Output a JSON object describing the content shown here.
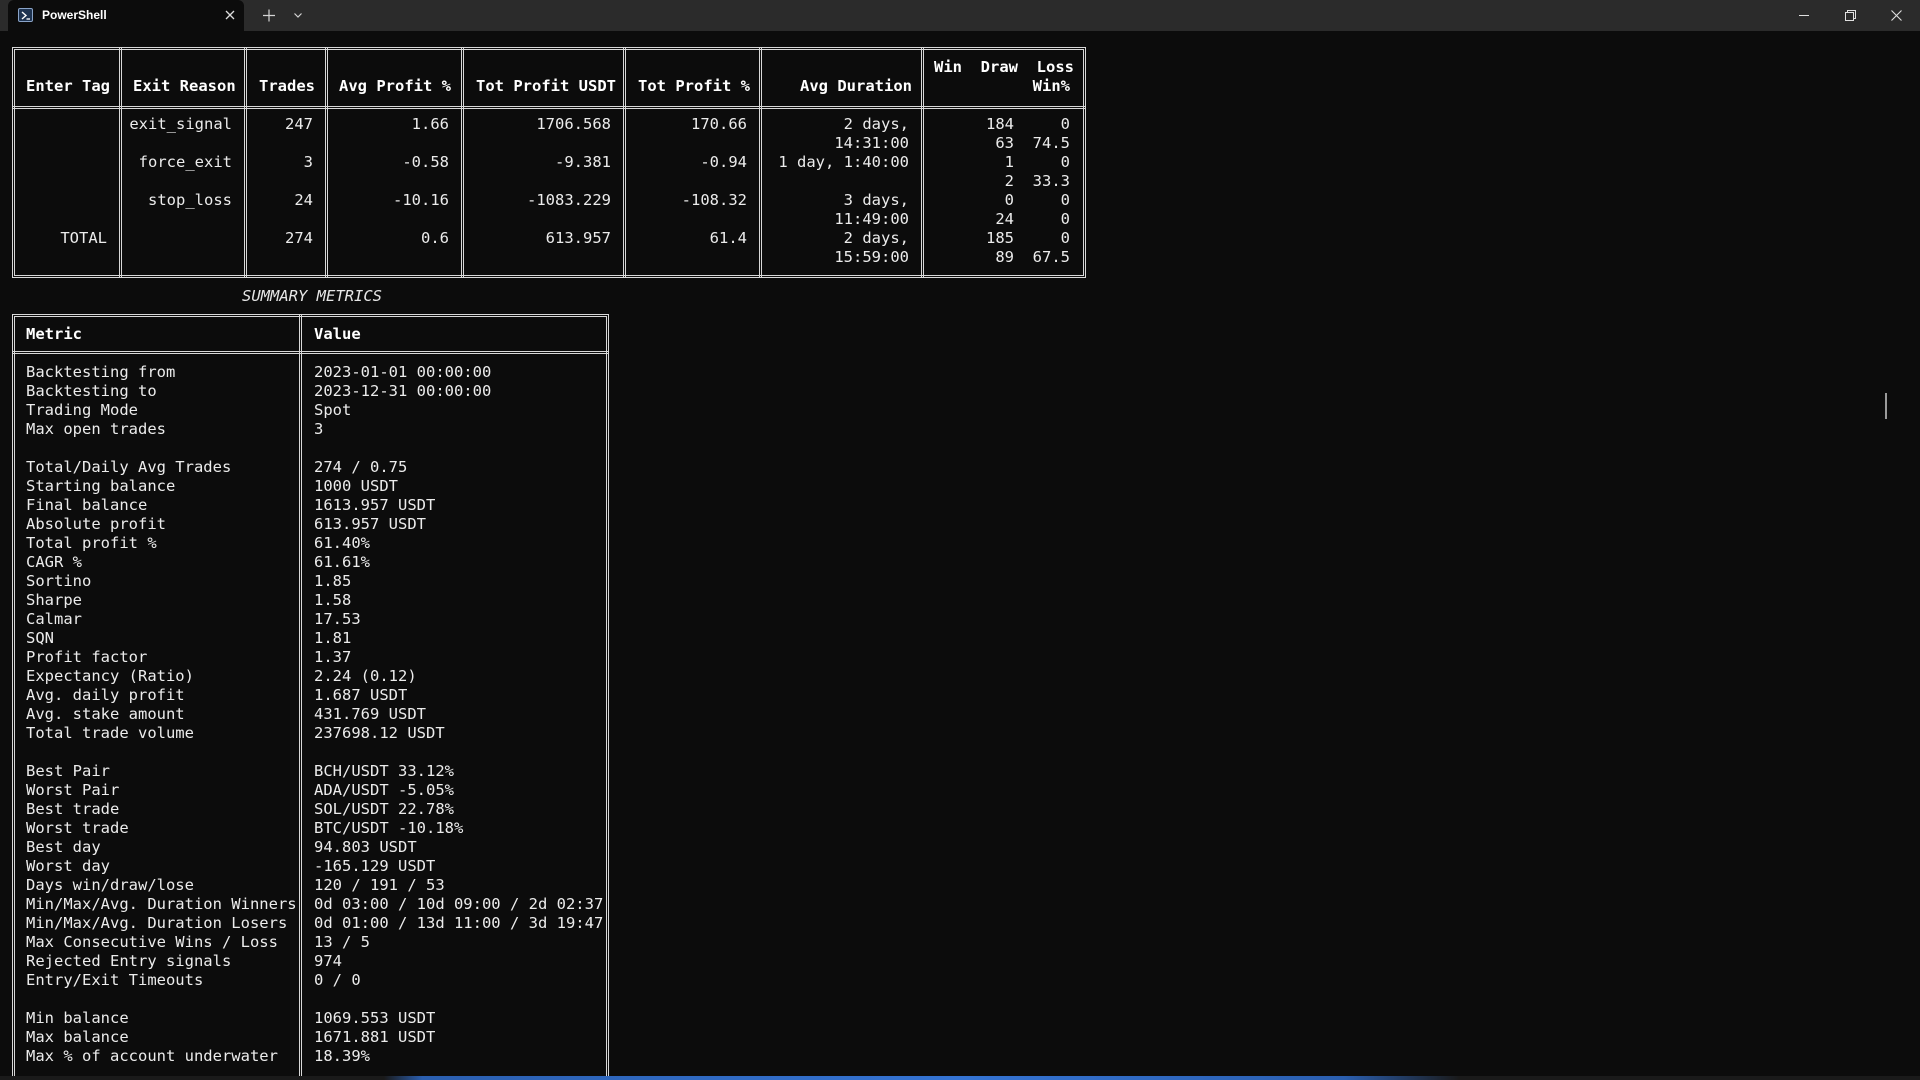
{
  "window": {
    "tab_title": "PowerShell",
    "new_tab_icon": "plus-icon",
    "dropdown_icon": "chevron-down-icon",
    "minimize_icon": "minimize-icon",
    "maximize_icon": "restore-icon",
    "close_icon": "close-icon"
  },
  "exit_table": {
    "headers": {
      "enter_tag": "Enter Tag",
      "exit_reason": "Exit Reason",
      "trades": "Trades",
      "avg_profit": "Avg Profit %",
      "tot_profit_usdt": "Tot Profit USDT",
      "tot_profit_pct": "Tot Profit %",
      "avg_duration": "Avg Duration",
      "wdl_line1": "Win  Draw  Loss",
      "wdl_line2": "Win%"
    },
    "rows": [
      {
        "enter_tag": "",
        "exit_reason": "exit_signal",
        "trades": "247",
        "avg_profit": "1.66",
        "tot_profit_usdt": "1706.568",
        "tot_profit_pct": "170.66",
        "dur1": "2 days,",
        "dur2": "14:31:00",
        "wdl1": "184     0",
        "wdl2": "63  74.5"
      },
      {
        "enter_tag": "",
        "exit_reason": "force_exit",
        "trades": "3",
        "avg_profit": "-0.58",
        "tot_profit_usdt": "-9.381",
        "tot_profit_pct": "-0.94",
        "dur1": "1 day, 1:40:00",
        "dur2": "",
        "wdl1": "1     0",
        "wdl2": "2  33.3"
      },
      {
        "enter_tag": "",
        "exit_reason": "stop_loss",
        "trades": "24",
        "avg_profit": "-10.16",
        "tot_profit_usdt": "-1083.229",
        "tot_profit_pct": "-108.32",
        "dur1": "3 days,",
        "dur2": "11:49:00",
        "wdl1": "0     0",
        "wdl2": "24     0"
      },
      {
        "enter_tag": "TOTAL",
        "exit_reason": "",
        "trades": "274",
        "avg_profit": "0.6",
        "tot_profit_usdt": "613.957",
        "tot_profit_pct": "61.4",
        "dur1": "2 days,",
        "dur2": "15:59:00",
        "wdl1": "185     0",
        "wdl2": "89  67.5"
      }
    ]
  },
  "summary": {
    "title": "SUMMARY METRICS",
    "header_metric": "Metric",
    "header_value": "Value",
    "rows": [
      [
        "Backtesting from",
        "2023-01-01 00:00:00"
      ],
      [
        "Backtesting to",
        "2023-12-31 00:00:00"
      ],
      [
        "Trading Mode",
        "Spot"
      ],
      [
        "Max open trades",
        "3"
      ],
      [
        "",
        ""
      ],
      [
        "Total/Daily Avg Trades",
        "274 / 0.75"
      ],
      [
        "Starting balance",
        "1000 USDT"
      ],
      [
        "Final balance",
        "1613.957 USDT"
      ],
      [
        "Absolute profit",
        "613.957 USDT"
      ],
      [
        "Total profit %",
        "61.40%"
      ],
      [
        "CAGR %",
        "61.61%"
      ],
      [
        "Sortino",
        "1.85"
      ],
      [
        "Sharpe",
        "1.58"
      ],
      [
        "Calmar",
        "17.53"
      ],
      [
        "SQN",
        "1.81"
      ],
      [
        "Profit factor",
        "1.37"
      ],
      [
        "Expectancy (Ratio)",
        "2.24 (0.12)"
      ],
      [
        "Avg. daily profit",
        "1.687 USDT"
      ],
      [
        "Avg. stake amount",
        "431.769 USDT"
      ],
      [
        "Total trade volume",
        "237698.12 USDT"
      ],
      [
        "",
        ""
      ],
      [
        "Best Pair",
        "BCH/USDT 33.12%"
      ],
      [
        "Worst Pair",
        "ADA/USDT -5.05%"
      ],
      [
        "Best trade",
        "SOL/USDT 22.78%"
      ],
      [
        "Worst trade",
        "BTC/USDT -10.18%"
      ],
      [
        "Best day",
        "94.803 USDT"
      ],
      [
        "Worst day",
        "-165.129 USDT"
      ],
      [
        "Days win/draw/lose",
        "120 / 191 / 53"
      ],
      [
        "Min/Max/Avg. Duration Winners",
        "0d 03:00 / 10d 09:00 / 2d 02:37"
      ],
      [
        "Min/Max/Avg. Duration Losers",
        "0d 01:00 / 13d 11:00 / 3d 19:47"
      ],
      [
        "Max Consecutive Wins / Loss",
        "13 / 5"
      ],
      [
        "Rejected Entry signals",
        "974"
      ],
      [
        "Entry/Exit Timeouts",
        "0 / 0"
      ],
      [
        "",
        ""
      ],
      [
        "Min balance",
        "1069.553 USDT"
      ],
      [
        "Max balance",
        "1671.881 USDT"
      ],
      [
        "Max % of account underwater",
        "18.39%"
      ]
    ]
  }
}
